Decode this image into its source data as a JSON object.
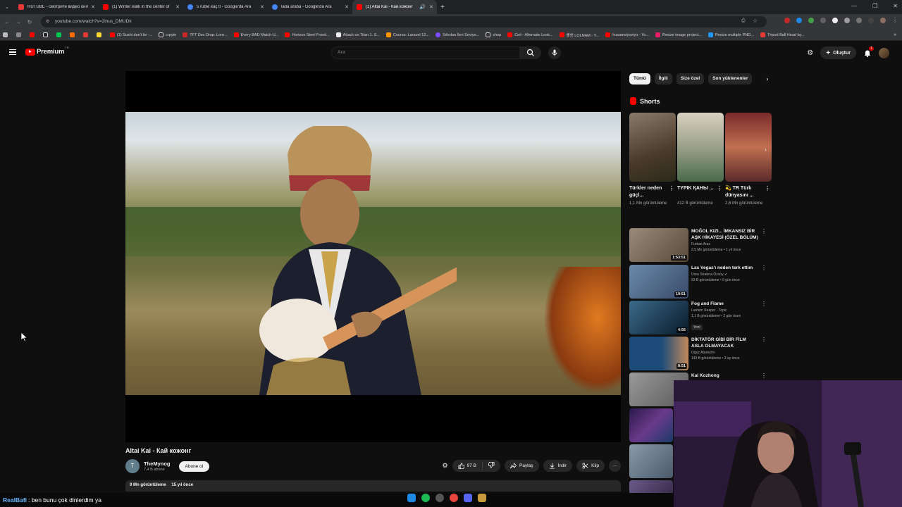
{
  "browser": {
    "tabs": [
      {
        "title": "RUTUBE - смотрите видео онл",
        "favcolor": "#e53935"
      },
      {
        "title": "(1) Winter walk in the center of",
        "favcolor": "#ff0000"
      },
      {
        "title": "5 ruble kaç tl - Google'da Ara",
        "favcolor": "#4285f4"
      },
      {
        "title": "lada araba - Google'da Ara",
        "favcolor": "#4285f4"
      },
      {
        "title": "(1) Altai Kai - Кай кожонг",
        "favcolor": "#ff0000"
      }
    ],
    "url": "youtube.com/watch?v=2lnus_DMUDk",
    "bookmarks": [
      "(1) Sushi don't lie -...",
      "crpyto",
      "TFT Dev Drop: Lore...",
      "Every BAD Match-U...",
      "Horizon Steel Fronti...",
      "Attack on Titan 1. S...",
      "Course: Laravel 12...",
      "Sıfırdan İleri Seviye...",
      "shop",
      "Ceti - Alternate Look...",
      "롤방 LOLNAM - Y...",
      "husamviyuviyu - Yo...",
      "Resize image project...",
      "Resize multiple PNG...",
      "Tripod Ball Head by..."
    ]
  },
  "youtube": {
    "logo_text": "Premium",
    "logo_sup": "TR",
    "search_placeholder": "Ara",
    "create_label": "Oluştur",
    "notif_count": "1"
  },
  "video": {
    "title": "Altai Kai - Кай кожонг",
    "channel": "TheMynog",
    "subscribers": "7,4 B abone",
    "subscribe_label": "Abone ol",
    "likes": "97 B",
    "share_label": "Paylaş",
    "download_label": "İndir",
    "clip_label": "Klip",
    "views": "9 Mn görüntüleme",
    "age": "15 yıl önce",
    "channel_initial": "T"
  },
  "chips": [
    "Tümü",
    "İlgili",
    "Size özel",
    "Son yüklenenler"
  ],
  "shorts": {
    "heading": "Shorts",
    "items": [
      {
        "title": "Türkler neden güçl...",
        "views": "1,1 Mn görüntüleme",
        "bg": "#5a4a3a"
      },
      {
        "title": "TYPIK ҚАНЫ ...",
        "views": "412 B görüntüleme",
        "bg": "#3a5a3a"
      },
      {
        "title": "💫 TR Türk dünyasını ...",
        "views": "2,6 Mn görüntüleme",
        "bg": "#6a2a2a"
      }
    ]
  },
  "recommendations": [
    {
      "title": "MOĞOL KIZI... İMKANSIZ BİR AŞK HİKAYESİ (ÖZEL BÖLÜM)",
      "channel": "Furkan Aras",
      "meta": "2,5 Mn görüntüleme • 1 yıl önce",
      "duration": "1:53:51",
      "bg": "#7a6a5a",
      "badge": ""
    },
    {
      "title": "Las Vegas'ı neden terk ettim",
      "channel": "Dora Stratera Özsoy ✔",
      "meta": "93 B görüntüleme • 9 gün önce",
      "duration": "19:51",
      "bg": "#4a6a8a",
      "badge": ""
    },
    {
      "title": "Fog and Flame",
      "channel": "Lantern Keeper - Topic",
      "meta": "1,1 B görüntüleme • 2 gün önce",
      "duration": "4:56",
      "bg": "#1a3a5a",
      "badge": "Yeni"
    },
    {
      "title": "DİKTATÖR GİBİ BİR FİLM ASLA OLMAYACAK",
      "channel": "Oğuz Ataresmi",
      "meta": "140 B görüntüleme • 3 ay önce",
      "duration": "8:51",
      "bg": "#1e4c7a",
      "badge": ""
    },
    {
      "title": "Kai Kozhong",
      "channel": "",
      "meta": "",
      "duration": "",
      "bg": "#8a8a8a",
      "badge": ""
    }
  ],
  "chat": {
    "user": "RealBafi",
    "message": ": ben bunu çok dinlerdim ya"
  }
}
